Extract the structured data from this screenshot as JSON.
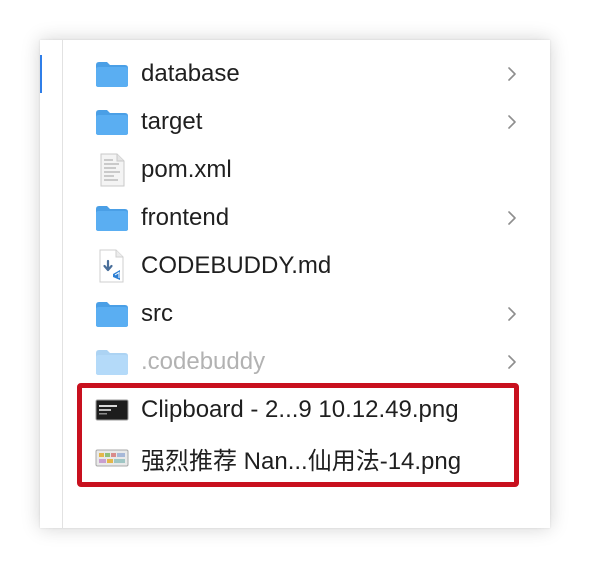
{
  "finder": {
    "items": [
      {
        "name": "database",
        "kind": "folder-icon",
        "has_children": true,
        "dimmed": false
      },
      {
        "name": "target",
        "kind": "folder-icon",
        "has_children": true,
        "dimmed": false
      },
      {
        "name": "pom.xml",
        "kind": "xml-file-icon",
        "has_children": false,
        "dimmed": false
      },
      {
        "name": "frontend",
        "kind": "folder-icon",
        "has_children": true,
        "dimmed": false
      },
      {
        "name": "CODEBUDDY.md",
        "kind": "markdown-file-icon",
        "has_children": false,
        "dimmed": false
      },
      {
        "name": "src",
        "kind": "folder-icon",
        "has_children": true,
        "dimmed": false
      },
      {
        "name": ".codebuddy",
        "kind": "folder-icon",
        "has_children": true,
        "dimmed": true
      },
      {
        "name": "Clipboard - 2...9 10.12.49.png",
        "kind": "png-thumbnail-icon",
        "has_children": false,
        "dimmed": false
      },
      {
        "name": "强烈推荐 Nan...仙用法-14.png",
        "kind": "png-thumbnail-icon",
        "has_children": false,
        "dimmed": false
      }
    ]
  },
  "colors": {
    "folder": "#5aaef2",
    "folder_tab": "#4a9fe6",
    "highlight_border": "#c8101e",
    "sidebar_accent": "#2f7ee8"
  }
}
